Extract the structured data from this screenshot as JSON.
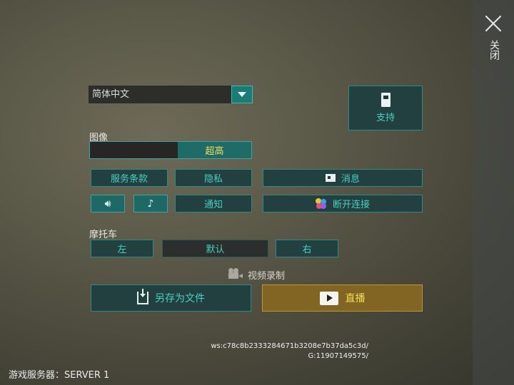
{
  "close": {
    "label": "关闭"
  },
  "language": {
    "selected": "简体中文"
  },
  "support": {
    "label": "支持"
  },
  "graphics": {
    "label": "图像",
    "quality_label": "超高"
  },
  "menu": {
    "terms": "服务条款",
    "privacy": "隐私",
    "news": "消息",
    "notify": "通知",
    "disconnect": "断开连接"
  },
  "audio": {
    "sound_icon": "speaker-icon",
    "music_icon": "music-note-icon"
  },
  "motorcycle": {
    "label": "摩托车",
    "left": "左",
    "default": "默认",
    "right": "右"
  },
  "recording": {
    "label": "视频录制",
    "save_file": "另存为文件",
    "live": "直播"
  },
  "ids": {
    "ws": "ws:c78c8b2333284671b3208e7b37da5c3d/",
    "g": "G:11907149575/"
  },
  "server": {
    "text": "游戏服务器：SERVER 1"
  },
  "colors": {
    "accent": "#46d0c3",
    "highlight": "#f2e05a",
    "live": "#8a6a1e"
  }
}
